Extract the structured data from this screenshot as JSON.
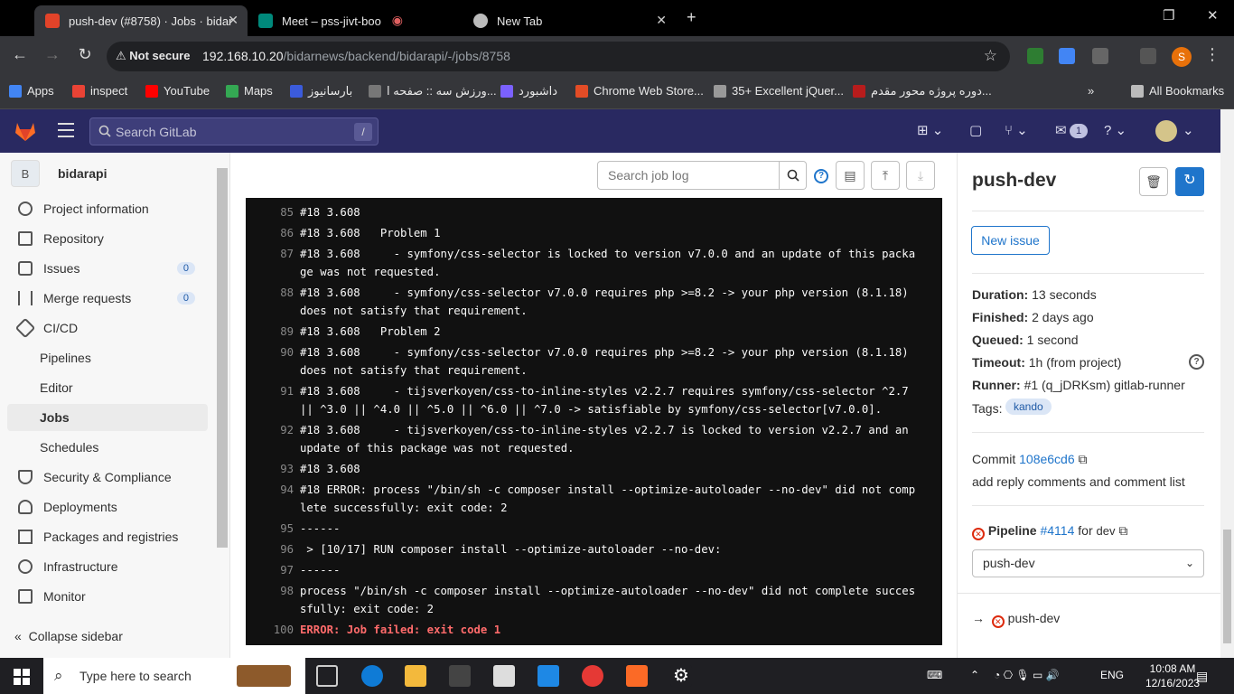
{
  "browser": {
    "tabs": [
      {
        "title": "push-dev (#8758) · Jobs · bidar"
      },
      {
        "title": "Meet – pss-jivt-boo"
      },
      {
        "title": "New Tab"
      }
    ],
    "security_label": "Not secure",
    "url_host": "192.168.10.20",
    "url_path": "/bidarnews/backend/bidarapi/-/jobs/8758",
    "profile_initial": "S",
    "bookmarks": [
      "Apps",
      "inspect",
      "YouTube",
      "Maps",
      "بارسانیوز",
      "ورزش سه :: صفحه ا...",
      "داشبورد",
      "Chrome Web Store...",
      "35+ Excellent jQuer...",
      "دوره پروژه محور مقدم..."
    ],
    "all_bookmarks": "All Bookmarks"
  },
  "gitlab": {
    "search_placeholder": "Search GitLab",
    "search_shortcut": "/",
    "todo_count": "1"
  },
  "sidebar": {
    "project_initial": "B",
    "project_name": "bidarapi",
    "items": [
      {
        "label": "Project information"
      },
      {
        "label": "Repository"
      },
      {
        "label": "Issues",
        "count": "0"
      },
      {
        "label": "Merge requests",
        "count": "0"
      },
      {
        "label": "CI/CD"
      },
      {
        "label": "Pipelines"
      },
      {
        "label": "Editor"
      },
      {
        "label": "Jobs"
      },
      {
        "label": "Schedules"
      },
      {
        "label": "Security & Compliance"
      },
      {
        "label": "Deployments"
      },
      {
        "label": "Packages and registries"
      },
      {
        "label": "Infrastructure"
      },
      {
        "label": "Monitor"
      }
    ],
    "collapse_label": "Collapse sidebar"
  },
  "joblog": {
    "search_placeholder": "Search job log",
    "lines": [
      {
        "n": "85",
        "t": "#18 3.608"
      },
      {
        "n": "86",
        "t": "#18 3.608   Problem 1"
      },
      {
        "n": "87",
        "t": "#18 3.608     - symfony/css-selector is locked to version v7.0.0 and an update of this package was not requested."
      },
      {
        "n": "88",
        "t": "#18 3.608     - symfony/css-selector v7.0.0 requires php >=8.2 -> your php version (8.1.18) does not satisfy that requirement."
      },
      {
        "n": "89",
        "t": "#18 3.608   Problem 2"
      },
      {
        "n": "90",
        "t": "#18 3.608     - symfony/css-selector v7.0.0 requires php >=8.2 -> your php version (8.1.18) does not satisfy that requirement."
      },
      {
        "n": "91",
        "t": "#18 3.608     - tijsverkoyen/css-to-inline-styles v2.2.7 requires symfony/css-selector ^2.7 || ^3.0 || ^4.0 || ^5.0 || ^6.0 || ^7.0 -> satisfiable by symfony/css-selector[v7.0.0]."
      },
      {
        "n": "92",
        "t": "#18 3.608     - tijsverkoyen/css-to-inline-styles v2.2.7 is locked to version v2.2.7 and an update of this package was not requested."
      },
      {
        "n": "93",
        "t": "#18 3.608"
      },
      {
        "n": "94",
        "t": "#18 ERROR: process \"/bin/sh -c composer install --optimize-autoloader --no-dev\" did not complete successfully: exit code: 2"
      },
      {
        "n": "95",
        "t": "------"
      },
      {
        "n": "96",
        "t": " > [10/17] RUN composer install --optimize-autoloader --no-dev:"
      },
      {
        "n": "97",
        "t": "------"
      },
      {
        "n": "98",
        "t": "process \"/bin/sh -c composer install --optimize-autoloader --no-dev\" did not complete successfully: exit code: 2"
      },
      {
        "n": "100",
        "t": "ERROR: Job failed: exit code 1"
      }
    ]
  },
  "job": {
    "title": "push-dev",
    "new_issue_label": "New issue",
    "duration_label": "Duration:",
    "duration": "13 seconds",
    "finished_label": "Finished:",
    "finished": "2 days ago",
    "queued_label": "Queued:",
    "queued": "1 second",
    "timeout_label": "Timeout:",
    "timeout": "1h (from project)",
    "runner_label": "Runner:",
    "runner": "#1 (q_jDRKsm) gitlab-runner",
    "tags_label": "Tags:",
    "tag": "kando",
    "commit_label": "Commit",
    "commit_sha": "108e6cd6",
    "commit_message": "add reply comments and comment list",
    "pipeline_label": "Pipeline",
    "pipeline_id": "#4114",
    "pipeline_for": "for",
    "pipeline_ref": "dev",
    "stage_select": "push-dev",
    "job_link": "push-dev"
  },
  "taskbar": {
    "search_placeholder": "Type here to search",
    "lang": "ENG",
    "time": "10:08 AM",
    "date": "12/16/2023"
  }
}
